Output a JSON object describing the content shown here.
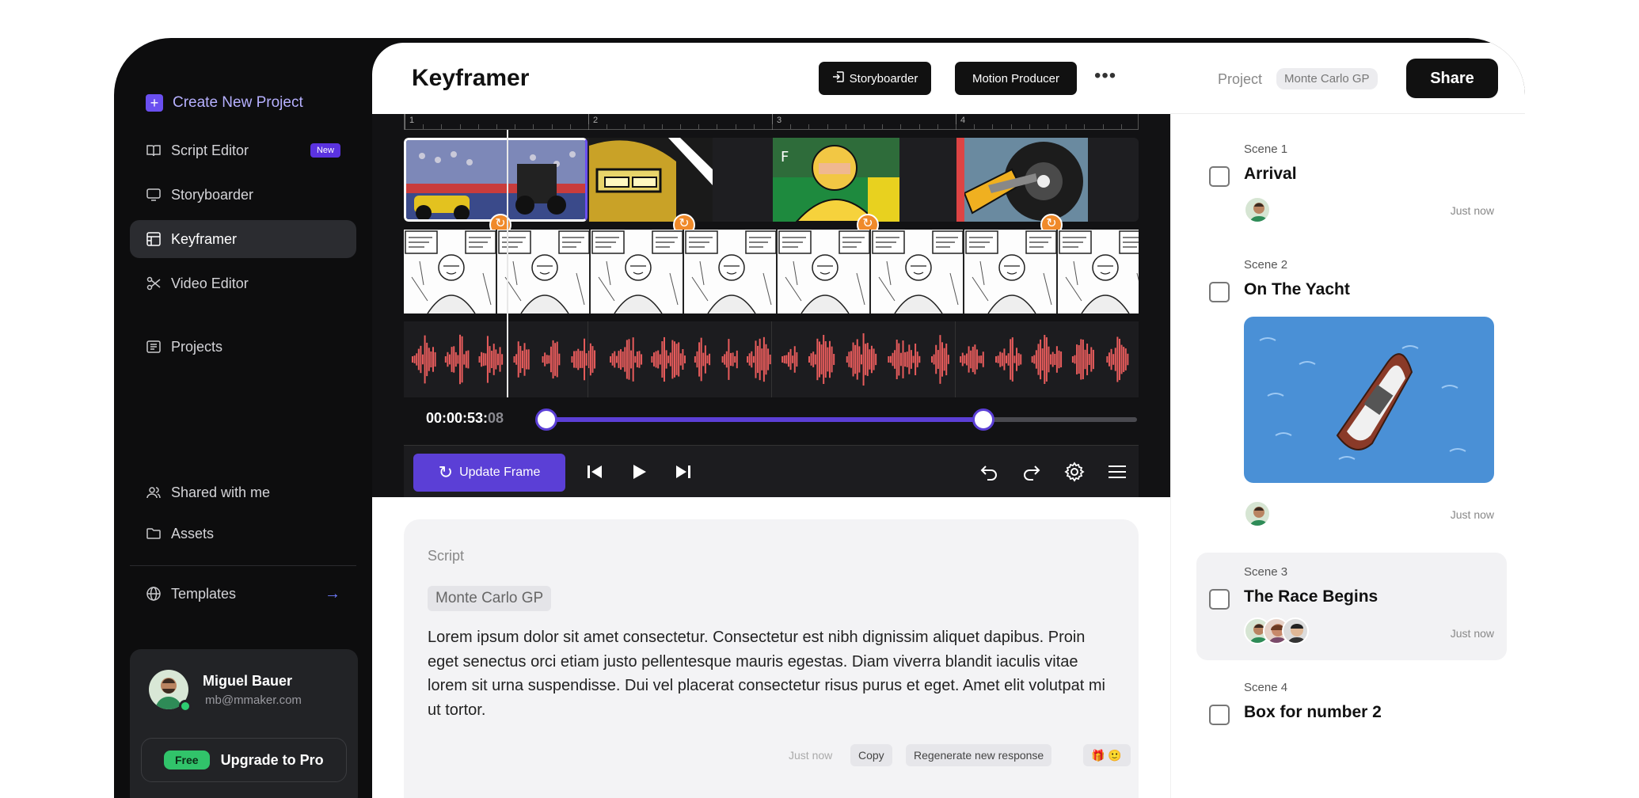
{
  "sidebar": {
    "create_label": "Create New Project",
    "items": [
      {
        "label": "Script Editor",
        "icon": "book-icon",
        "badge": "New"
      },
      {
        "label": "Storyboarder",
        "icon": "monitor-icon"
      },
      {
        "label": "Keyframer",
        "icon": "keyframer-icon"
      },
      {
        "label": "Video Editor",
        "icon": "scissors-icon"
      },
      {
        "label": "Projects",
        "icon": "projects-icon"
      }
    ],
    "shared_label": "Shared with me",
    "assets_label": "Assets",
    "templates_label": "Templates",
    "user": {
      "name": "Miguel Bauer",
      "email": "mb@mmaker.com"
    },
    "upgrade": {
      "badge": "Free",
      "label": "Upgrade to Pro"
    }
  },
  "header": {
    "title": "Keyframer",
    "storyboarder_btn": "Storyboarder",
    "motion_btn": "Motion Producer"
  },
  "timeline": {
    "ruler_marks": [
      "1",
      "2",
      "3",
      "4"
    ],
    "timecode": "00:00:53:",
    "timecode_frames": "08",
    "progress": 0.74,
    "update_label": "Update Frame"
  },
  "script": {
    "label": "Script",
    "chip": "Monte Carlo GP",
    "body": "Lorem ipsum dolor sit amet consectetur. Consectetur est nibh dignissim aliquet dapibus. Proin eget senectus orci etiam justo pellentesque mauris egestas. Diam viverra blandit iaculis vitae lorem sit urna suspendisse. Dui vel placerat consectetur risus purus et eget. Amet elit volutpat mi ut tortor.",
    "time": "Just now",
    "copy_label": "Copy",
    "regenerate_label": "Regenerate new response"
  },
  "project": {
    "label": "Project",
    "name": "Monte Carlo GP",
    "share_label": "Share"
  },
  "scenes": [
    {
      "num": "Scene 1",
      "title": "Arrival",
      "time": "Just now"
    },
    {
      "num": "Scene 2",
      "title": "On The Yacht",
      "time": "Just now"
    },
    {
      "num": "Scene 3",
      "title": "The Race Begins",
      "time": "Just now"
    },
    {
      "num": "Scene 4",
      "title": "Box for number 2"
    }
  ],
  "colors": {
    "accent": "#5b3fd6",
    "waveform": "#e85c5c",
    "refresh": "#f08a2a",
    "online": "#2ecc71"
  }
}
